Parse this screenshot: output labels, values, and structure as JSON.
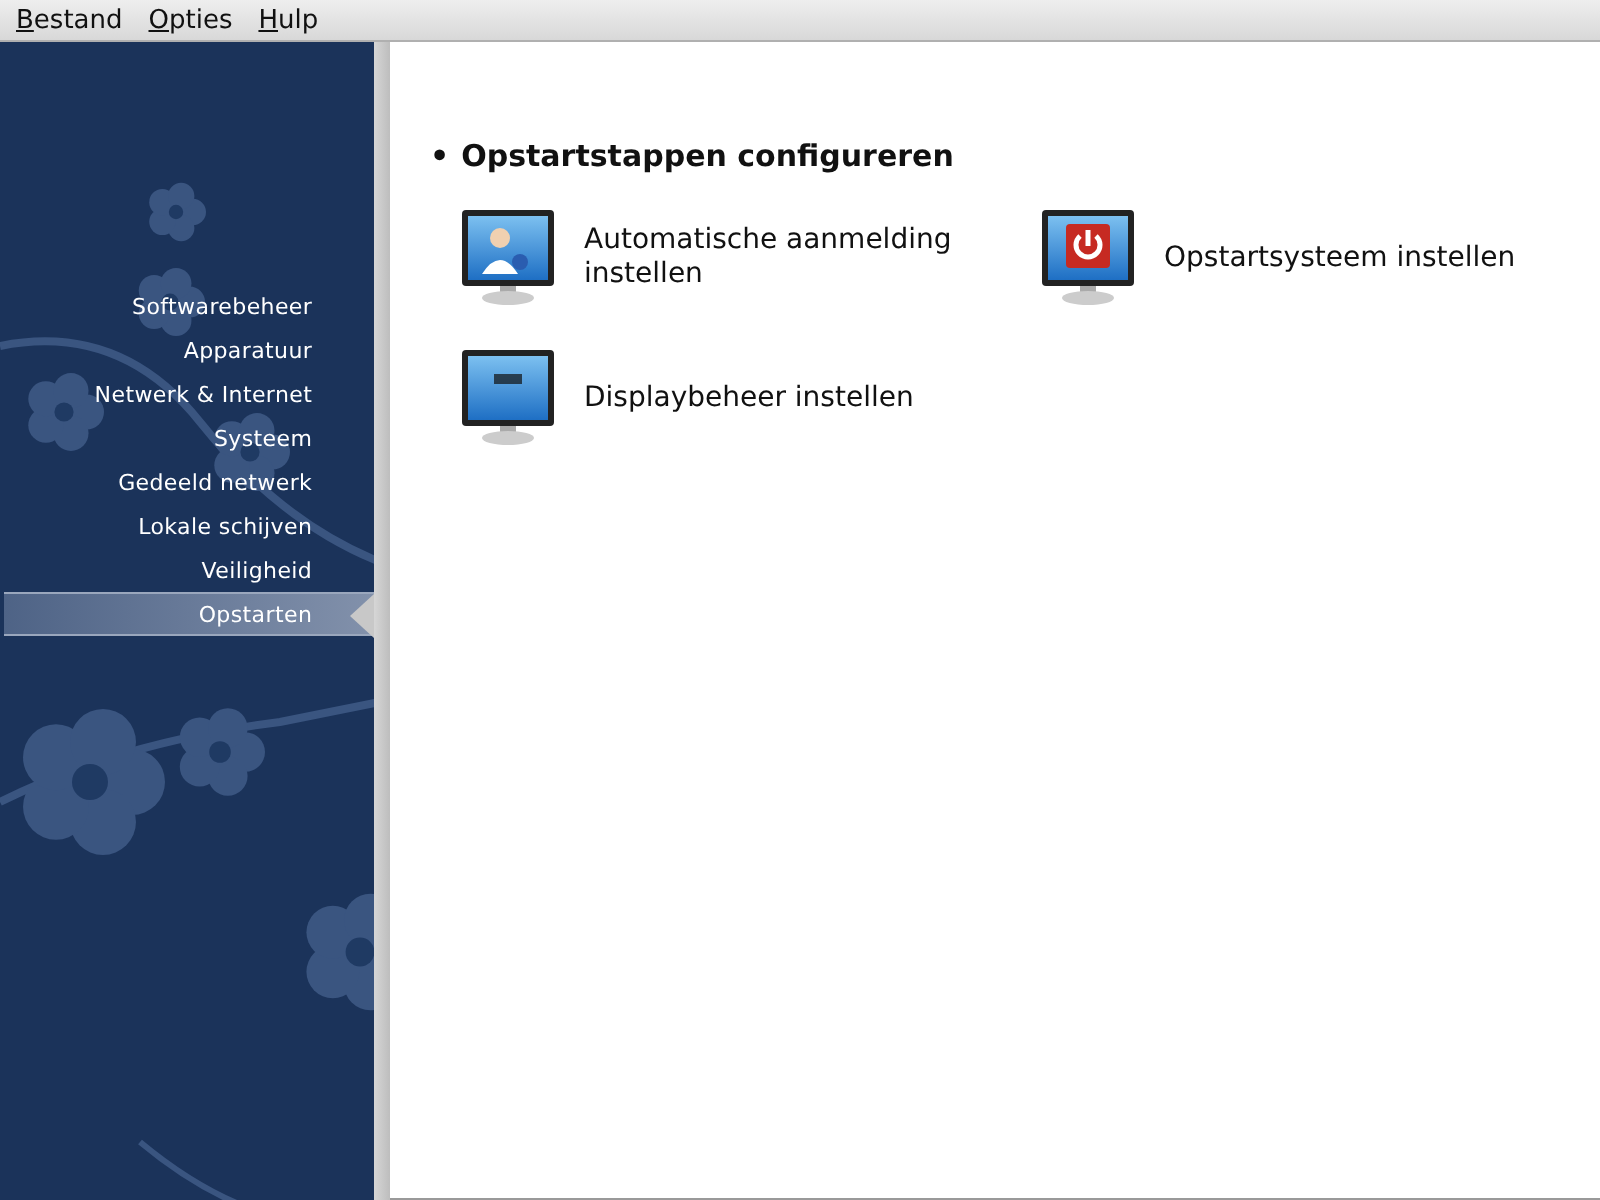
{
  "menu": [
    "Bestand",
    "Opties",
    "Hulp"
  ],
  "sidebar": {
    "items": [
      {
        "label": "Softwarebeheer",
        "selected": false
      },
      {
        "label": "Apparatuur",
        "selected": false
      },
      {
        "label": "Netwerk & Internet",
        "selected": false
      },
      {
        "label": "Systeem",
        "selected": false
      },
      {
        "label": "Gedeeld netwerk",
        "selected": false
      },
      {
        "label": "Lokale schijven",
        "selected": false
      },
      {
        "label": "Veiligheid",
        "selected": false
      },
      {
        "label": "Opstarten",
        "selected": true
      }
    ]
  },
  "section": {
    "bullet": "•",
    "title": "Opstartstappen configureren",
    "tools": [
      {
        "kind": "autologin",
        "label": "Automatische aanmelding instellen"
      },
      {
        "kind": "bootloader",
        "label": "Opstartsysteem instellen"
      },
      {
        "kind": "displaymanager",
        "label": "Displaybeheer instellen"
      }
    ]
  }
}
